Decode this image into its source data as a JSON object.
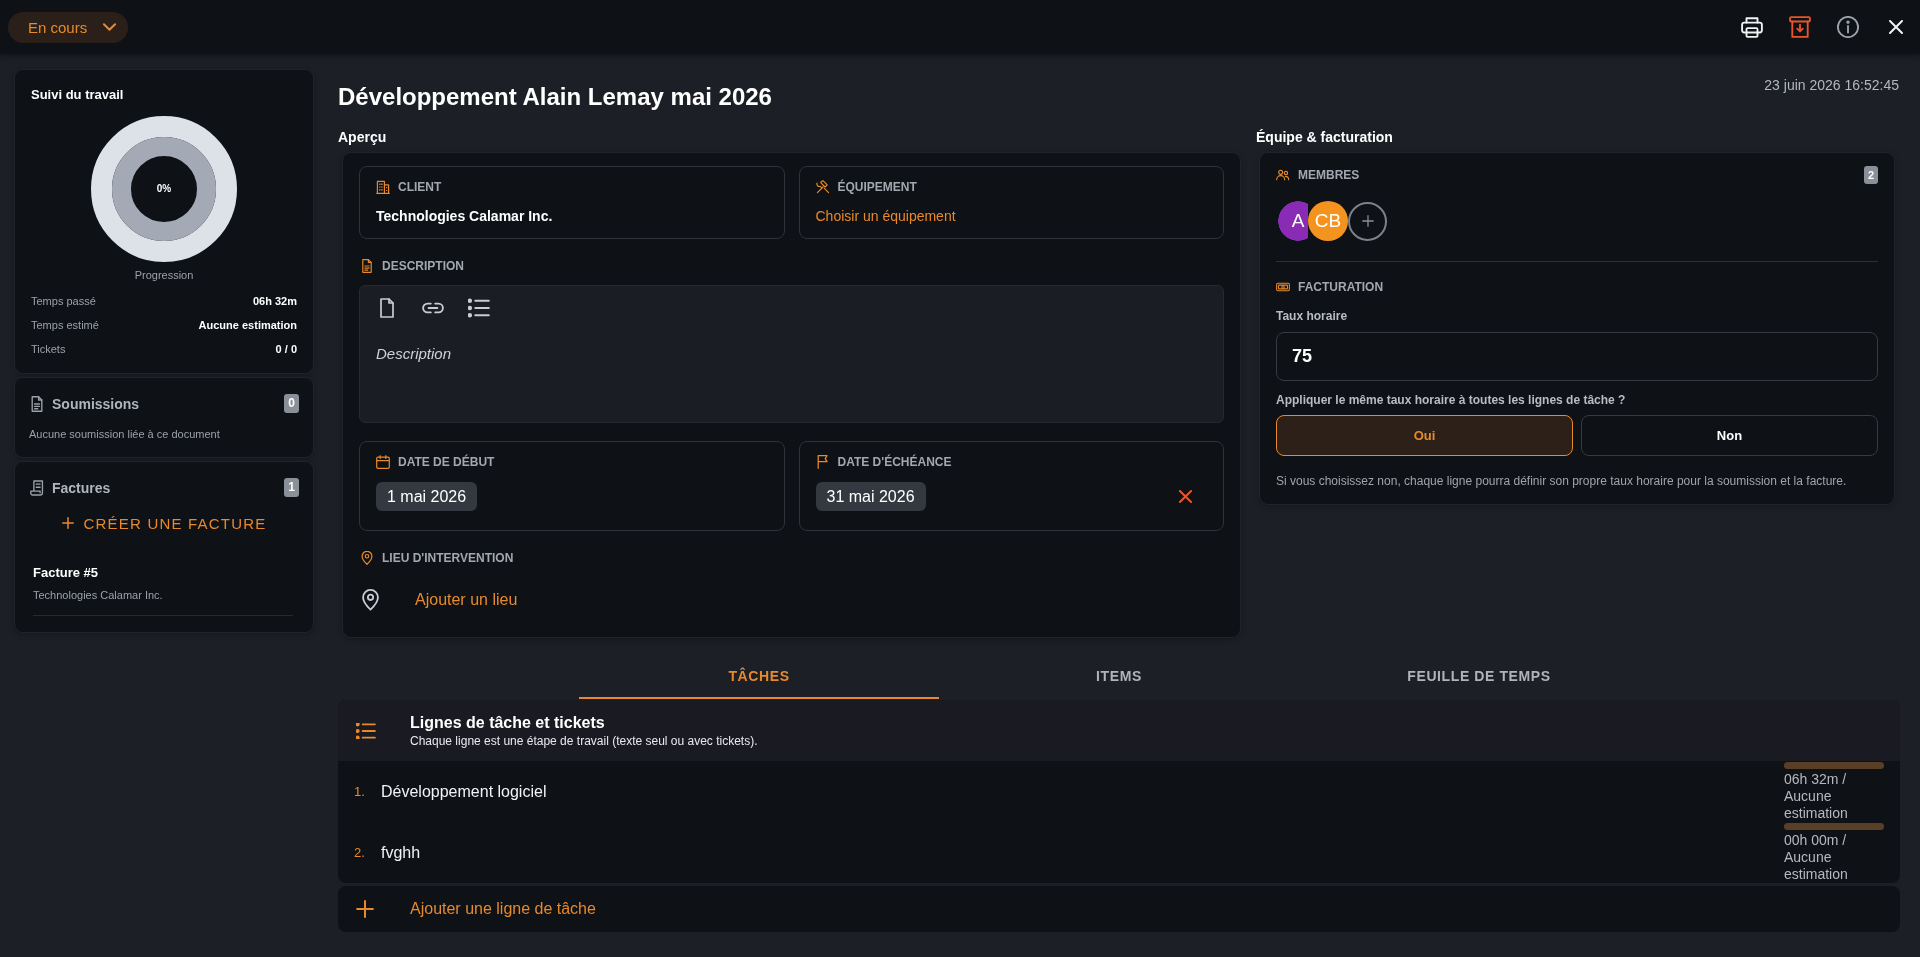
{
  "top_bar": {
    "status": "En cours"
  },
  "sidebar": {
    "work_tracking": {
      "title": "Suivi du travail",
      "percent": "0%",
      "caption": "Progression",
      "stats": [
        {
          "label": "Temps passé",
          "value": "06h 32m"
        },
        {
          "label": "Temps estimé",
          "value": "Aucune estimation"
        },
        {
          "label": "Tickets",
          "value": "0 / 0"
        }
      ]
    },
    "submissions": {
      "title": "Soumissions",
      "count": "0",
      "empty_text": "Aucune soumission liée à ce document"
    },
    "invoices": {
      "title": "Factures",
      "count": "1",
      "create_label": "CRÉER UNE FACTURE",
      "items": [
        {
          "title": "Facture #5",
          "client": "Technologies Calamar Inc."
        }
      ]
    }
  },
  "header": {
    "title": "Développement Alain Lemay mai 2026",
    "timestamp": "23 juin 2026 16:52:45"
  },
  "overview": {
    "label": "Aperçu",
    "client": {
      "label": "CLIENT",
      "value": "Technologies Calamar Inc."
    },
    "equipment": {
      "label": "ÉQUIPEMENT",
      "action": "Choisir un équipement"
    },
    "description": {
      "label": "DESCRIPTION",
      "placeholder": "Description"
    },
    "start_date": {
      "label": "DATE DE DÉBUT",
      "value": "1 mai 2026"
    },
    "due_date": {
      "label": "DATE D'ÉCHÉANCE",
      "value": "31 mai 2026"
    },
    "location": {
      "label": "LIEU D'INTERVENTION",
      "action": "Ajouter un lieu"
    }
  },
  "team_billing": {
    "label": "Équipe & facturation",
    "members": {
      "label": "MEMBRES",
      "count": "2",
      "avatars": [
        {
          "initials": "A",
          "color": "#8a2bb5"
        },
        {
          "initials": "CB",
          "color": "#f5931f"
        }
      ]
    },
    "billing": {
      "label": "FACTURATION",
      "rate_label": "Taux horaire",
      "rate_value": "75",
      "question": "Appliquer le même taux horaire à toutes les lignes de tâche ?",
      "options": [
        {
          "label": "Oui",
          "selected": true
        },
        {
          "label": "Non",
          "selected": false
        }
      ],
      "note": "Si vous choisissez non, chaque ligne pourra définir son propre taux horaire pour la soumission et la facture."
    }
  },
  "tabs": [
    {
      "label": "TÂCHES",
      "selected": true
    },
    {
      "label": "ITEMS",
      "selected": false
    },
    {
      "label": "FEUILLE DE TEMPS",
      "selected": false
    }
  ],
  "task_lines": {
    "title": "Lignes de tâche et tickets",
    "subtitle": "Chaque ligne est une étape de travail (texte seul ou avec tickets).",
    "rows": [
      {
        "number": "1.",
        "name": "Développement logiciel",
        "time": "06h 32m / Aucune estimation",
        "level": 0
      },
      {
        "number": "2.",
        "name": "fvghh",
        "time": "00h 00m / Aucune estimation",
        "level": 0
      }
    ],
    "add_label": "Ajouter une ligne de tâche"
  }
}
